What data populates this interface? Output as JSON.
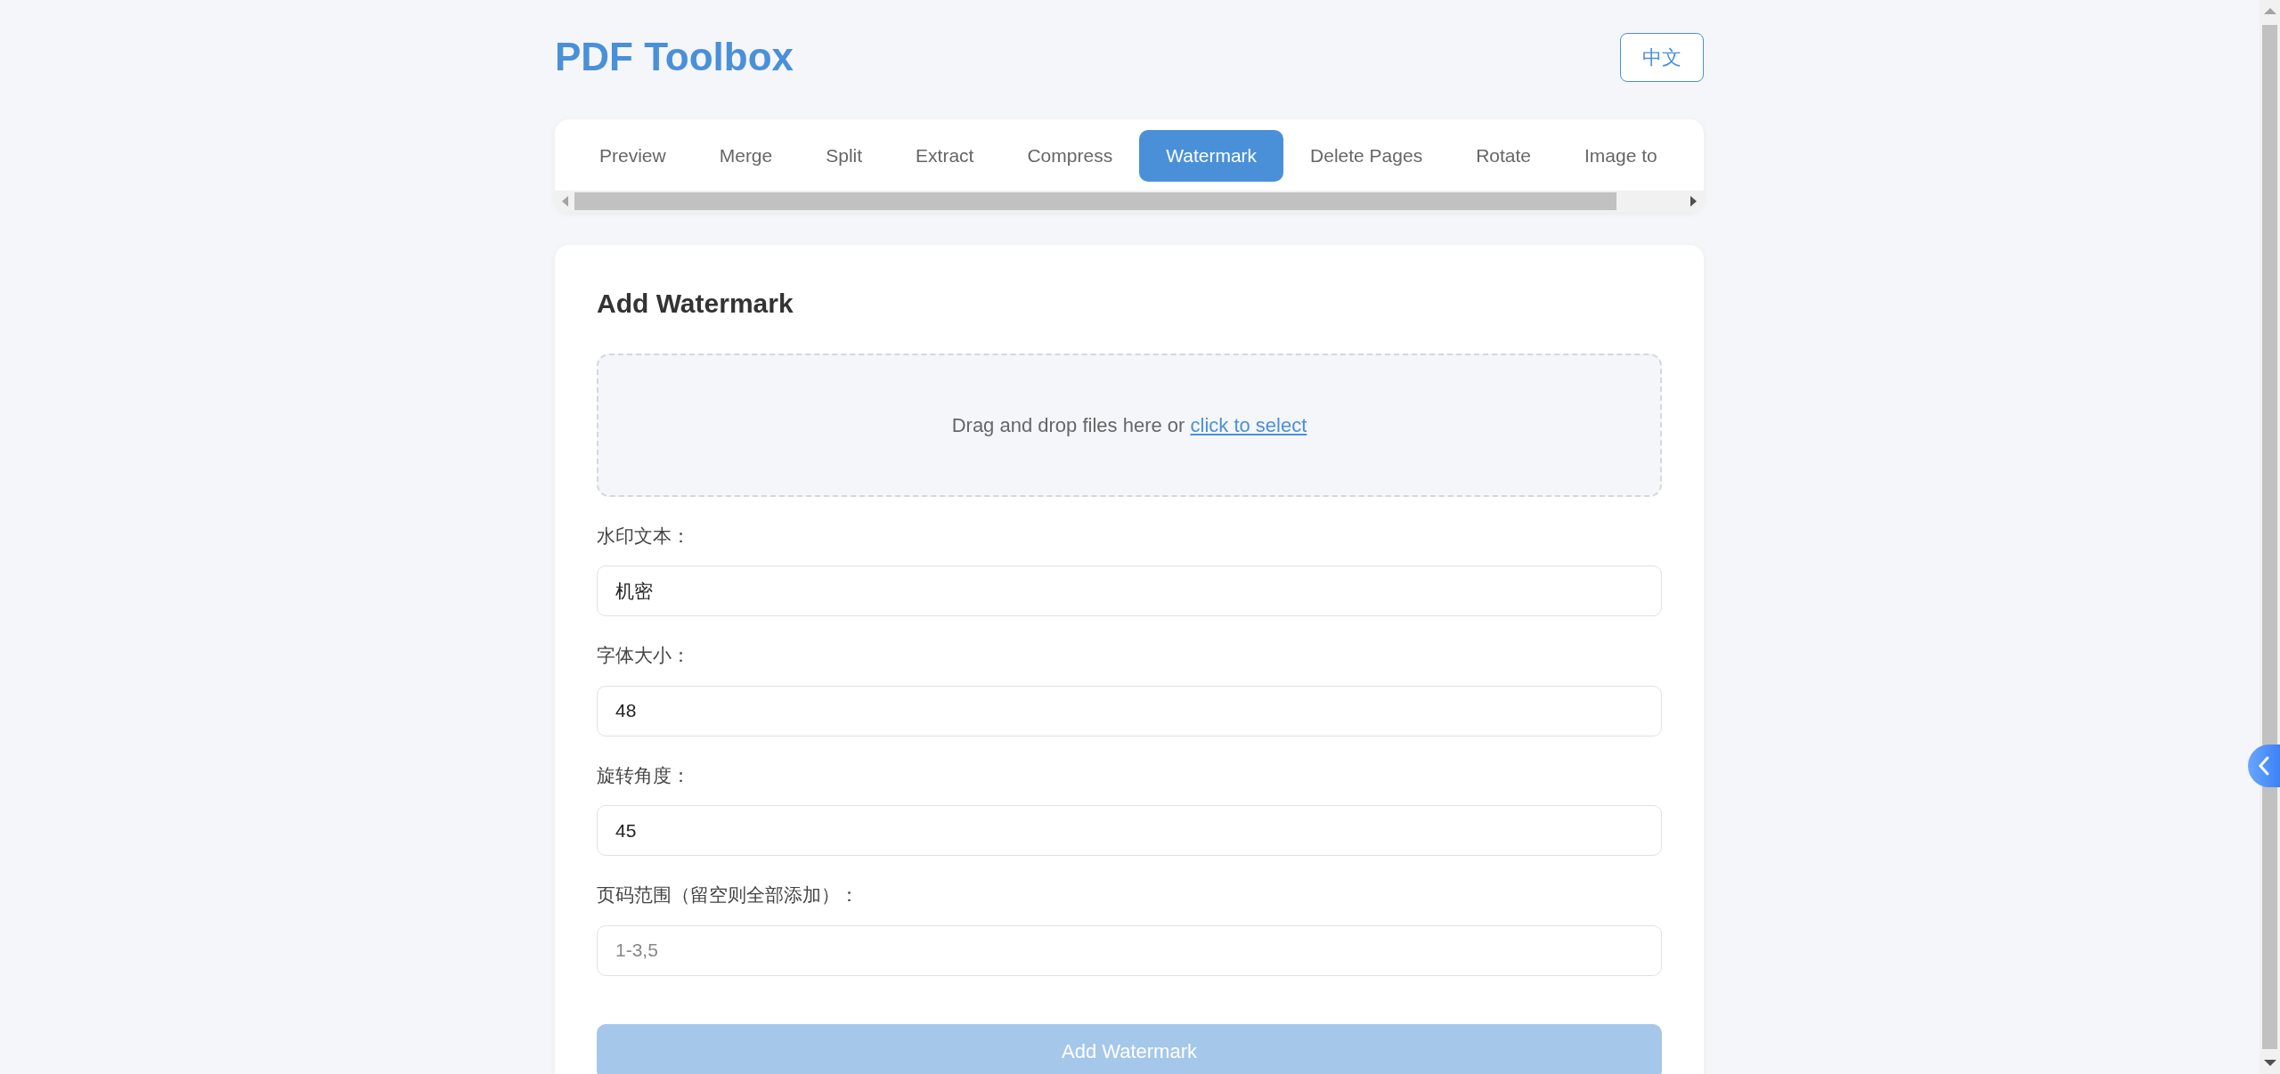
{
  "header": {
    "title": "PDF Toolbox",
    "language_button": "中文"
  },
  "tabs": [
    {
      "label": "Preview",
      "selected": false
    },
    {
      "label": "Merge",
      "selected": false
    },
    {
      "label": "Split",
      "selected": false
    },
    {
      "label": "Extract",
      "selected": false
    },
    {
      "label": "Compress",
      "selected": false
    },
    {
      "label": "Watermark",
      "selected": true
    },
    {
      "label": "Delete Pages",
      "selected": false
    },
    {
      "label": "Rotate",
      "selected": false
    },
    {
      "label": "Image to",
      "selected": false
    }
  ],
  "panel": {
    "title": "Add Watermark",
    "dropzone": {
      "text": "Drag and drop files here or ",
      "link": "click to select"
    },
    "fields": [
      {
        "label": "水印文本：",
        "value": "机密"
      },
      {
        "label": "字体大小：",
        "value": "48"
      },
      {
        "label": "旋转角度：",
        "value": "45"
      },
      {
        "label": "页码范围（留空则全部添加）：",
        "placeholder": "1-3,5"
      }
    ],
    "submit": {
      "label": "Add Watermark",
      "disabled": true
    }
  }
}
